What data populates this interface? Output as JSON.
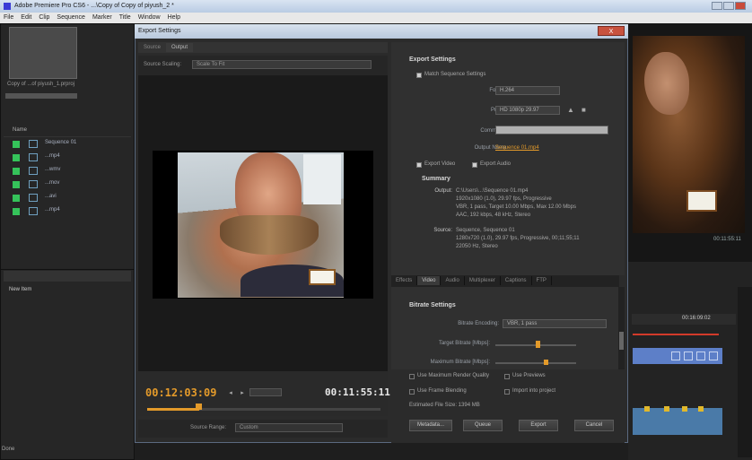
{
  "os_window": {
    "title": "Adobe Premiere Pro CS6 - ...\\Copy of Copy of piyush_2 *"
  },
  "menubar": [
    "File",
    "Edit",
    "Clip",
    "Sequence",
    "Marker",
    "Title",
    "Window",
    "Help"
  ],
  "project_panel": {
    "clip_name": "Copy of ...of piyush_1.prproj",
    "column_name": "Name",
    "items": [
      "Sequence 01",
      "...mp4",
      "...wmv",
      "...mov",
      "...avi",
      "...mp4"
    ]
  },
  "effects_panel": {
    "item": "New Item"
  },
  "status": {
    "text": "Done"
  },
  "program_monitor": {
    "timecode": "00:11:55:11"
  },
  "timeline": {
    "timecode": "00:16:09:02"
  },
  "dialog": {
    "title": "Export Settings",
    "close_label": "X",
    "source_tabs": [
      "Source",
      "Output"
    ],
    "active_source_tab": "Output",
    "source_scaling_label": "Source Scaling:",
    "source_scaling_value": "Scale To Fit",
    "timecode_in": "00:12:03:09",
    "timecode_out": "00:11:55:11",
    "source_range_label": "Source Range:",
    "source_range_value": "Custom",
    "export_settings": {
      "header": "Export Settings",
      "match_sequence": "Match Sequence Settings",
      "format_label": "Format:",
      "format_value": "H.264",
      "preset_label": "Preset:",
      "preset_value": "HD 1080p 29.97",
      "comments_label": "Comments:",
      "comments_value": "",
      "output_name_label": "Output Name:",
      "output_name_value": "Sequence 01.mp4",
      "export_video": "Export Video",
      "export_audio": "Export Audio"
    },
    "summary": {
      "header": "Summary",
      "output_label": "Output:",
      "output_lines": [
        "C:\\Users\\...\\Sequence 01.mp4",
        "1920x1080 (1.0), 29.97 fps, Progressive",
        "VBR, 1 pass, Target 10.00 Mbps, Max 12.00 Mbps",
        "AAC, 192 kbps, 48 kHz, Stereo"
      ],
      "source_label": "Source:",
      "source_lines": [
        "Sequence, Sequence 01",
        "1280x720 (1.0), 29.97 fps, Progressive, 00;11;55;11",
        "22050 Hz, Stereo"
      ]
    },
    "tabs": [
      "Effects",
      "Video",
      "Audio",
      "Multiplexer",
      "Captions",
      "FTP"
    ],
    "active_tab": "Video",
    "bitrate": {
      "header": "Bitrate Settings",
      "encoding_label": "Bitrate Encoding:",
      "encoding_value": "VBR, 1 pass",
      "target_label": "Target Bitrate [Mbps]:",
      "target_value": 10,
      "max_label": "Maximum Bitrate [Mbps]:",
      "max_value": 12
    },
    "options": {
      "max_render_quality": "Use Maximum Render Quality",
      "use_previews": "Use Previews",
      "frame_blending": "Use Frame Blending",
      "import_into_project": "Import into project",
      "estimated_size": "Estimated File Size: 1394 MB"
    },
    "buttons": {
      "metadata": "Metadata...",
      "queue": "Queue",
      "export": "Export",
      "cancel": "Cancel"
    }
  }
}
